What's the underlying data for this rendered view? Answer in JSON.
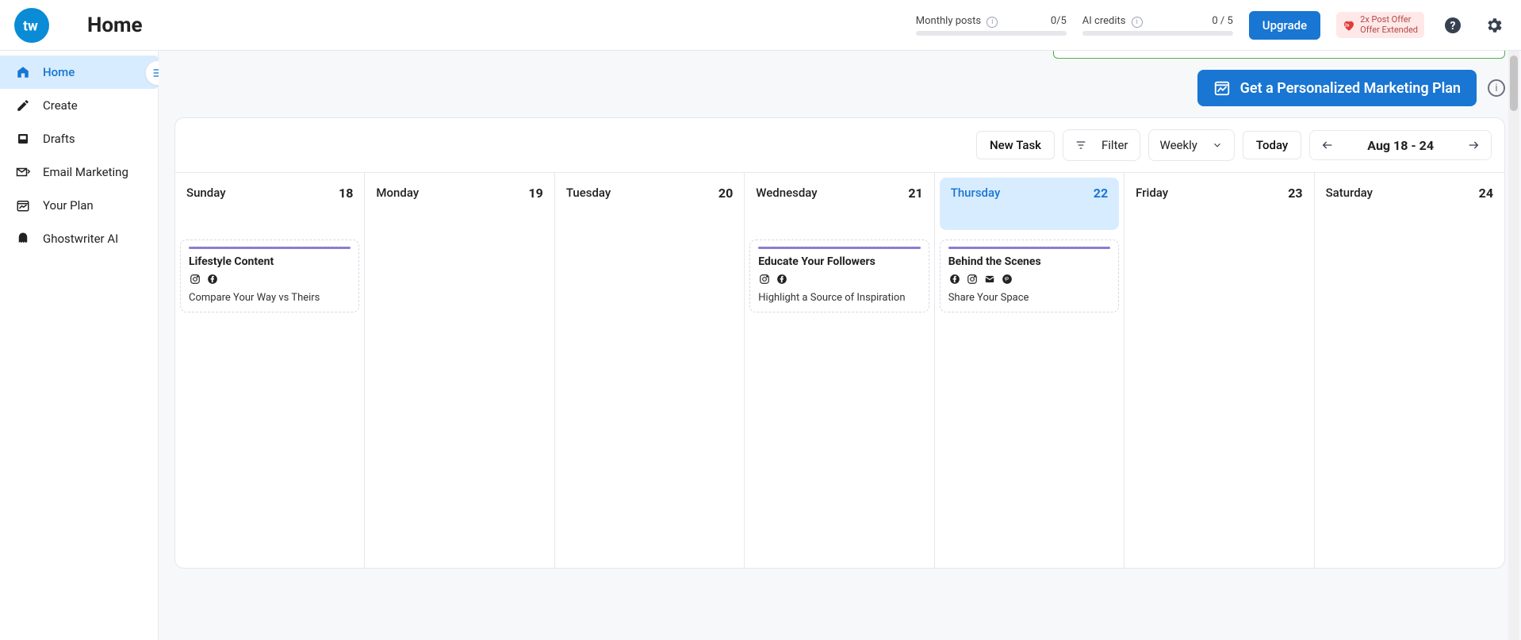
{
  "header": {
    "page_title": "Home",
    "meter1_label": "Monthly posts",
    "meter1_value": "0/5",
    "meter2_label": "AI credits",
    "meter2_value": "0 / 5",
    "upgrade": "Upgrade",
    "offer_line1": "2x Post Offer",
    "offer_line2": "Offer Extended"
  },
  "sidebar": {
    "items": [
      {
        "label": "Home"
      },
      {
        "label": "Create"
      },
      {
        "label": "Drafts"
      },
      {
        "label": "Email Marketing"
      },
      {
        "label": "Your Plan"
      },
      {
        "label": "Ghostwriter AI"
      }
    ]
  },
  "plan_button": "Get a Personalized Marketing Plan",
  "toolbar": {
    "new_task": "New Task",
    "filter": "Filter",
    "view": "Weekly",
    "today": "Today",
    "range": "Aug 18 - 24"
  },
  "days": [
    {
      "name": "Sunday",
      "num": "18"
    },
    {
      "name": "Monday",
      "num": "19"
    },
    {
      "name": "Tuesday",
      "num": "20"
    },
    {
      "name": "Wednesday",
      "num": "21"
    },
    {
      "name": "Thursday",
      "num": "22"
    },
    {
      "name": "Friday",
      "num": "23"
    },
    {
      "name": "Saturday",
      "num": "24"
    }
  ],
  "cards": {
    "sun": {
      "title": "Lifestyle Content",
      "desc": "Compare Your Way vs Theirs",
      "icons": [
        "instagram",
        "facebook"
      ]
    },
    "wed": {
      "title": "Educate Your Followers",
      "desc": "Highlight a Source of Inspiration",
      "icons": [
        "instagram",
        "facebook"
      ]
    },
    "thu": {
      "title": "Behind the Scenes",
      "desc": "Share Your Space",
      "icons": [
        "facebook",
        "instagram",
        "email",
        "pinterest"
      ]
    }
  }
}
